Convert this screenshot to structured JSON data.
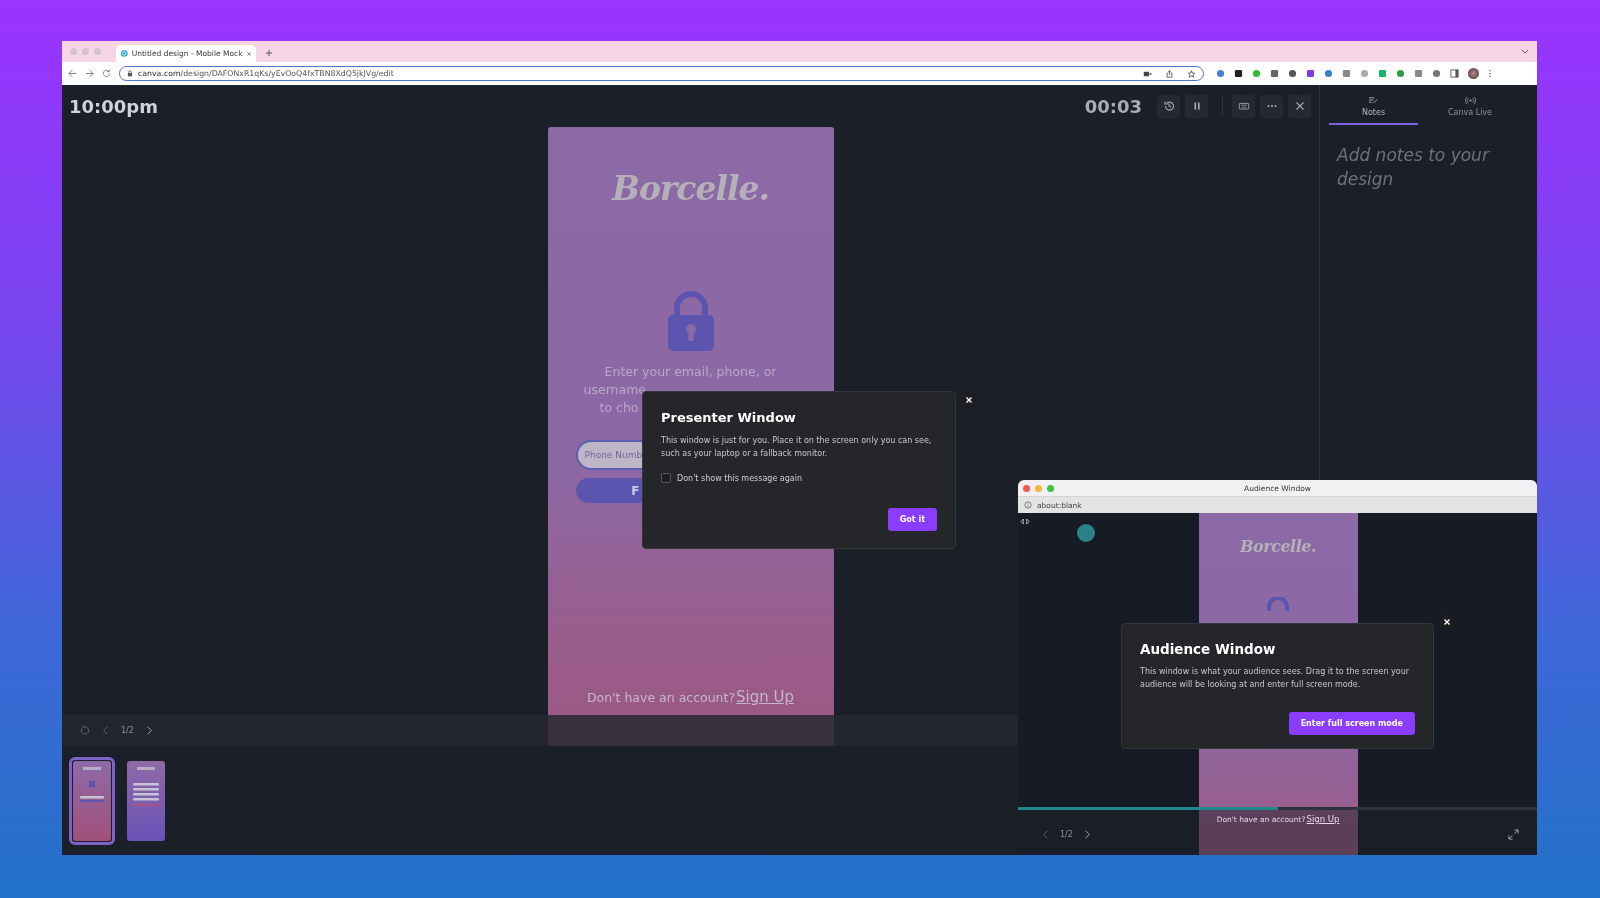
{
  "browser": {
    "tab_title": "Untitled design - Mobile Mock",
    "url_host": "canva.com",
    "url_path": "/design/DAFONxR1qKs/yEvOoQ4fxTBN8XdQ5jkJVg/edit"
  },
  "presenter": {
    "clock": "10:00pm",
    "timer": "00:03",
    "slide": {
      "logo": "Borcelle.",
      "prompt_lines": [
        "Enter your email, phone, or",
        "username",
        "to cho"
      ],
      "field_placeholder": "Phone Numb",
      "button_label": "F",
      "footer_text": "Don't have an account?",
      "footer_link": "Sign Up"
    },
    "page_indicator": "1/2",
    "thumbnails": [
      {
        "kind": "lock",
        "selected": true
      },
      {
        "kind": "form",
        "selected": false
      }
    ]
  },
  "notes_panel": {
    "tabs": [
      {
        "label": "Notes",
        "selected": true
      },
      {
        "label": "Canva Live",
        "selected": false
      }
    ],
    "placeholder": "Add notes to your design"
  },
  "presenter_dialog": {
    "title": "Presenter Window",
    "body": "This window is just for you. Place it on the screen only you can see, such as your laptop or a fallback monitor.",
    "checkbox": {
      "label": "Don't show this message again",
      "checked": false
    },
    "button": "Got it"
  },
  "audience_window": {
    "title": "Audience Window",
    "url": "about:blank",
    "slide": {
      "logo": "Borcelle.",
      "footer_text": "Don't have an account?",
      "footer_link": "Sign Up"
    },
    "progress": {
      "level": 0.5
    },
    "page_indicator": "1/2",
    "dialog": {
      "title": "Audience Window",
      "body": "This window is what your audience sees. Drag it to the screen your audience will be looking at and enter full screen mode.",
      "button": "Enter full screen mode"
    }
  }
}
